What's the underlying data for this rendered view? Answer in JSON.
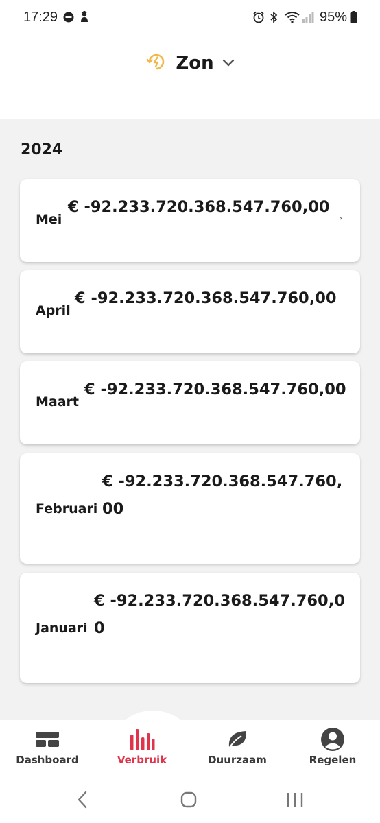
{
  "status_bar": {
    "time": "17:29",
    "battery_text": "95%",
    "icons": [
      "do-not-disturb-icon",
      "notification-app-icon",
      "alarm-icon",
      "bluetooth-icon",
      "wifi-icon",
      "signal-icon",
      "battery-icon"
    ]
  },
  "header": {
    "title": "Zon",
    "icon": "sun-energy-icon",
    "dropdown_icon": "chevron-down-icon",
    "accent_color": "#f2b84b"
  },
  "content": {
    "year": "2024",
    "months": [
      {
        "month": "Mei",
        "amount": "€ -92.233.720.368.547.760,00",
        "has_chevron": true
      },
      {
        "month": "April",
        "amount": "€ -92.233.720.368.547.760,00",
        "has_chevron": false
      },
      {
        "month": "Maart",
        "amount": "€ -92.233.720.368.547.760,00",
        "has_chevron": false
      },
      {
        "month": "Februari",
        "amount_line1": "€ -92.233.720.368.547.760,",
        "amount_line2": "00",
        "has_chevron": false
      },
      {
        "month": "Januari",
        "amount_line1": "€ -92.233.720.368.547.760,0",
        "amount_line2": "0",
        "has_chevron": false
      }
    ],
    "chevron_glyph": "›"
  },
  "bottom_nav": {
    "active_color": "#e0344a",
    "items": [
      {
        "label": "Dashboard",
        "icon": "dashboard-icon",
        "active": false
      },
      {
        "label": "Verbruik",
        "icon": "bar-chart-icon",
        "active": true
      },
      {
        "label": "Duurzaam",
        "icon": "leaf-icon",
        "active": false
      },
      {
        "label": "Regelen",
        "icon": "account-circle-icon",
        "active": false
      }
    ]
  },
  "system_nav": {
    "buttons": [
      "back-icon",
      "home-icon",
      "recents-icon"
    ]
  }
}
